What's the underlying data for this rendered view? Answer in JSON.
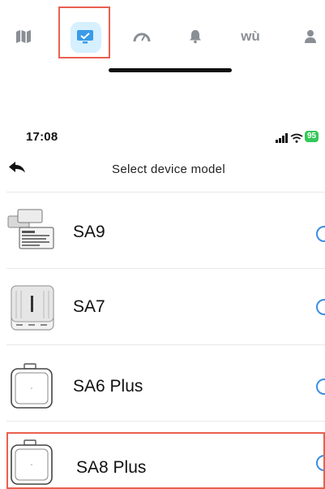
{
  "tabbar": {
    "tabs": [
      {
        "icon": "map-icon",
        "active": false
      },
      {
        "icon": "monitor-icon",
        "active": true
      },
      {
        "icon": "gauge-icon",
        "active": false
      },
      {
        "icon": "bell-icon",
        "active": false
      },
      {
        "icon": "wu-icon",
        "label": "wù",
        "active": false
      },
      {
        "icon": "person-icon",
        "active": false
      }
    ],
    "active_color": "#3a9be8"
  },
  "status": {
    "time": "17:08",
    "battery": "95"
  },
  "nav": {
    "title": "Select device model"
  },
  "devices": [
    {
      "label": "SA9",
      "thumbnail": "label-sheet-thumbnail",
      "selected": false
    },
    {
      "label": "SA7",
      "thumbnail": "printer-thumbnail",
      "selected": false
    },
    {
      "label": "SA6 Plus",
      "thumbnail": "square-device-thumbnail",
      "selected": false
    },
    {
      "label": "SA8 Plus",
      "thumbnail": "square-device-thumbnail",
      "selected": false
    }
  ],
  "colors": {
    "highlight": "#e9604f",
    "radio": "#3a8ee6",
    "battery": "#34c759"
  }
}
